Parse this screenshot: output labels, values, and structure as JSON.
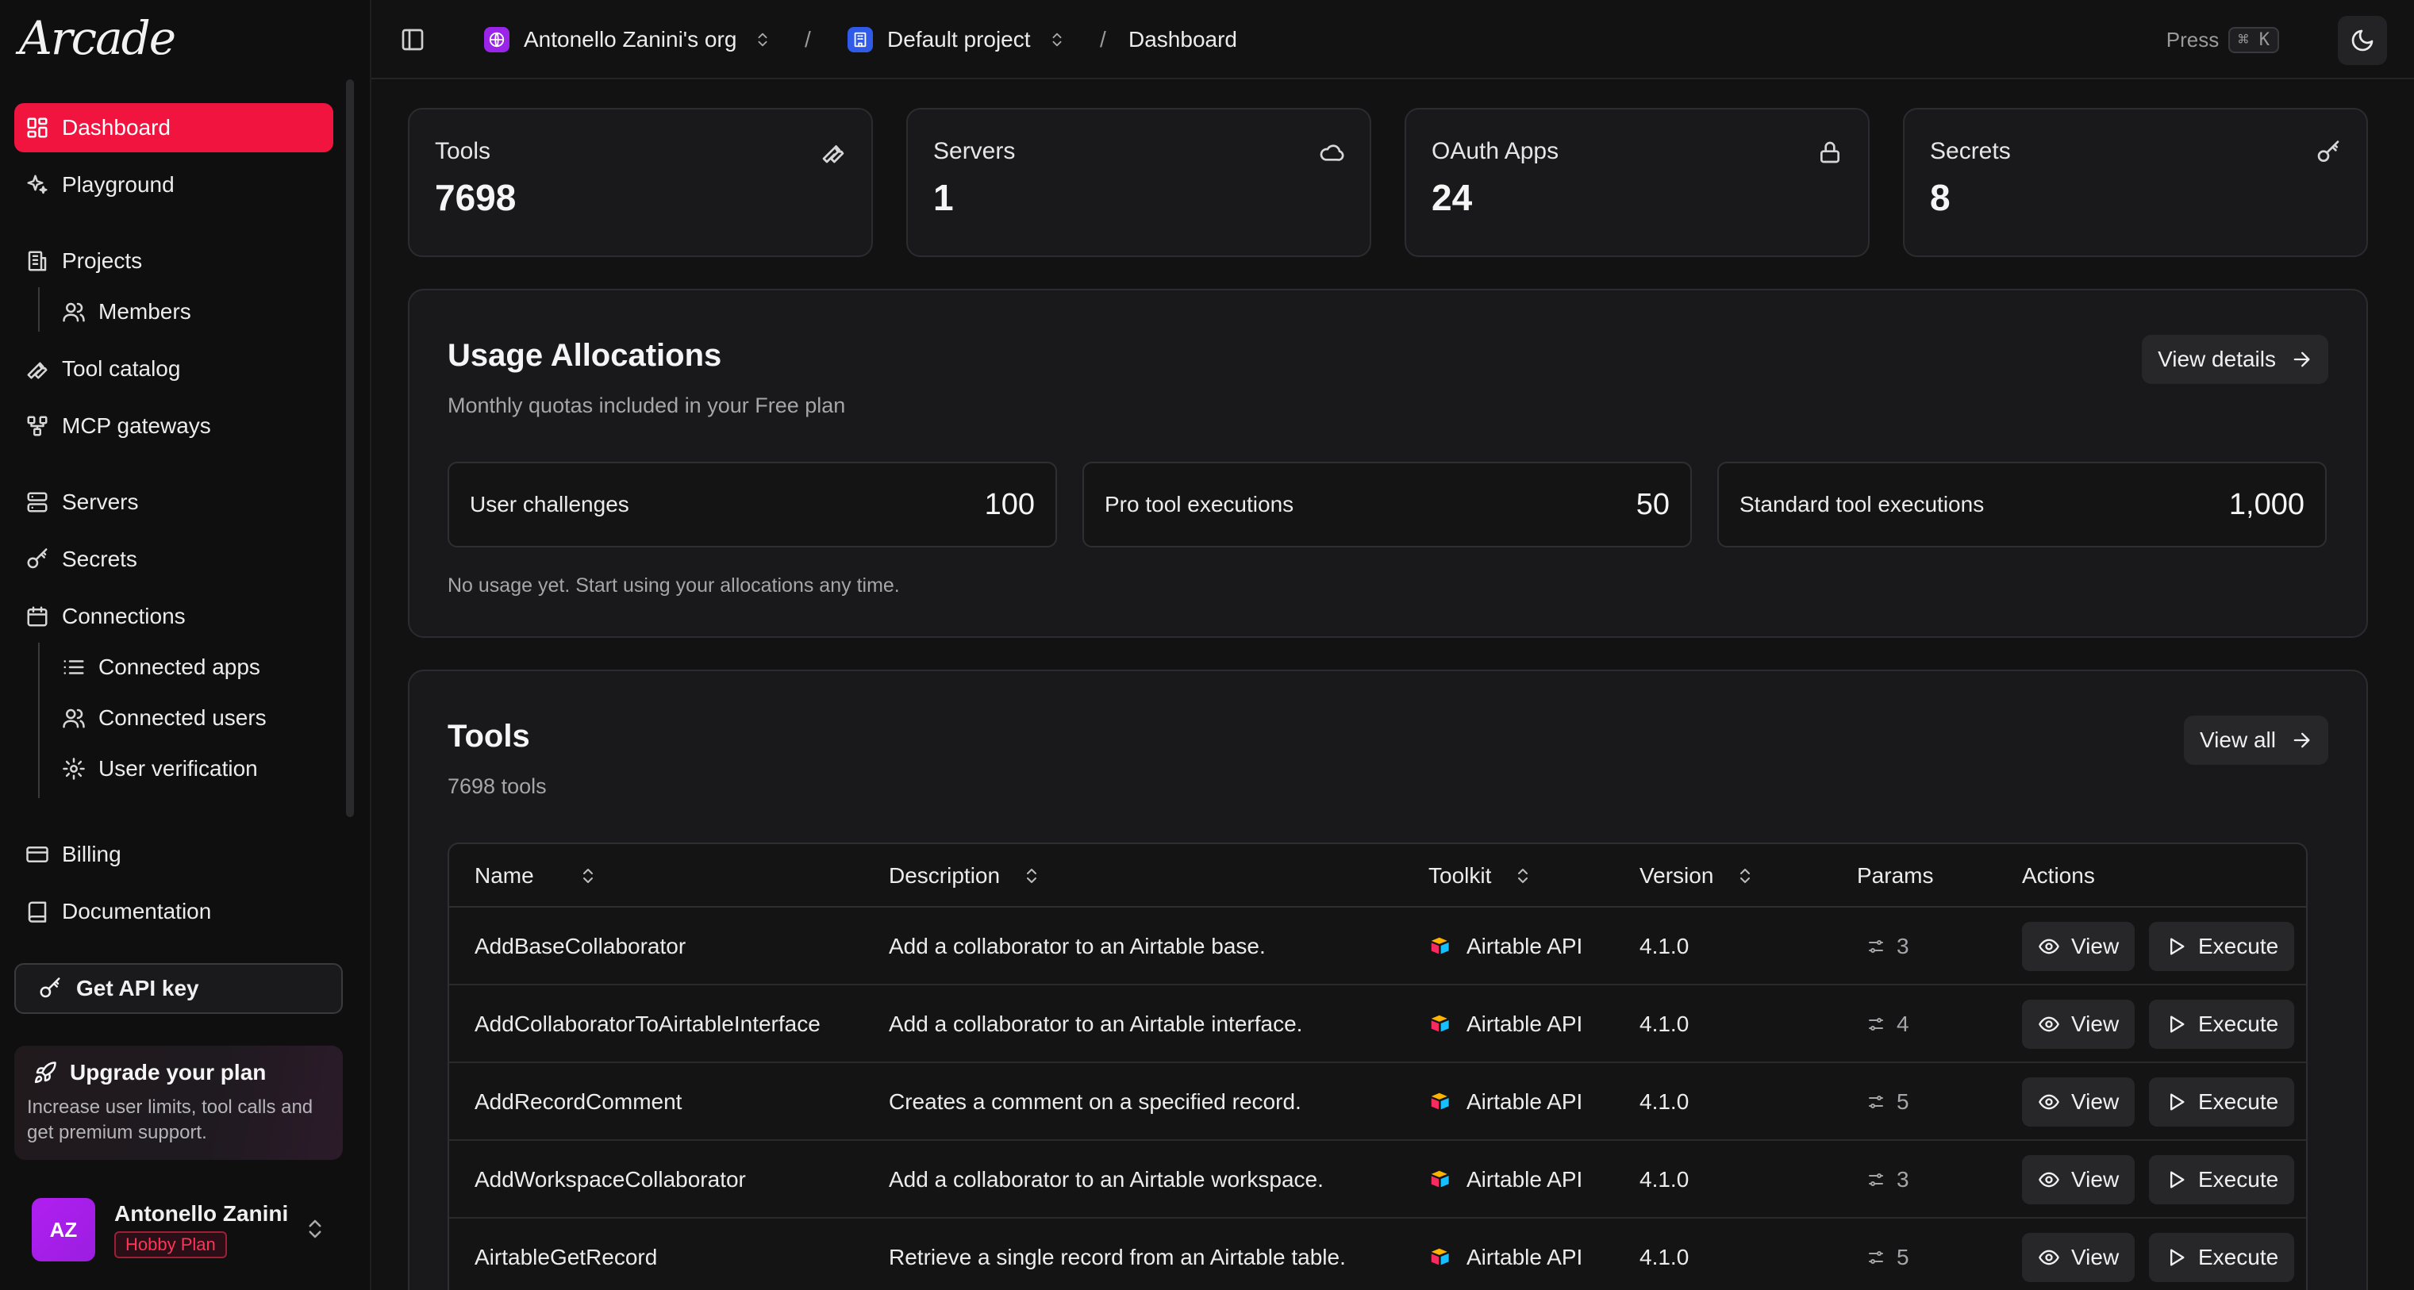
{
  "brand": {
    "logo_text": "Arcade"
  },
  "sidebar": {
    "items": [
      {
        "label": "Dashboard"
      },
      {
        "label": "Playground"
      },
      {
        "label": "Projects"
      },
      {
        "label": "Members"
      },
      {
        "label": "Tool catalog"
      },
      {
        "label": "MCP gateways"
      },
      {
        "label": "Servers"
      },
      {
        "label": "Secrets"
      },
      {
        "label": "Connections"
      },
      {
        "label": "Connected apps"
      },
      {
        "label": "Connected users"
      },
      {
        "label": "User verification"
      },
      {
        "label": "Billing"
      },
      {
        "label": "Documentation"
      }
    ],
    "api_key_label": "Get API key",
    "upgrade": {
      "title": "Upgrade your plan",
      "description": "Increase user limits, tool calls and get premium support."
    },
    "user": {
      "initials": "AZ",
      "name": "Antonello Zanini",
      "plan": "Hobby Plan"
    }
  },
  "topbar": {
    "org": "Antonello Zanini's org",
    "project": "Default project",
    "page": "Dashboard",
    "separator": "/",
    "press_label": "Press",
    "shortcut": "⌘ K"
  },
  "stats": [
    {
      "label": "Tools",
      "value": "7698",
      "icon": "wrench-icon"
    },
    {
      "label": "Servers",
      "value": "1",
      "icon": "cloud-icon"
    },
    {
      "label": "OAuth Apps",
      "value": "24",
      "icon": "lock-icon"
    },
    {
      "label": "Secrets",
      "value": "8",
      "icon": "key-icon"
    }
  ],
  "usage": {
    "title": "Usage Allocations",
    "subtitle": "Monthly quotas included in your Free plan",
    "details_label": "View details",
    "quotas": [
      {
        "label": "User challenges",
        "value": "100"
      },
      {
        "label": "Pro tool executions",
        "value": "50"
      },
      {
        "label": "Standard tool executions",
        "value": "1,000"
      }
    ],
    "note": "No usage yet. Start using your allocations any time."
  },
  "tools": {
    "title": "Tools",
    "count_label": "7698 tools",
    "view_all_label": "View all",
    "columns": [
      "Name",
      "Description",
      "Toolkit",
      "Version",
      "Params",
      "Actions"
    ],
    "view_label": "View",
    "execute_label": "Execute",
    "rows": [
      {
        "name": "AddBaseCollaborator",
        "description": "Add a collaborator to an Airtable base.",
        "toolkit": "Airtable API",
        "version": "4.1.0",
        "params": "3"
      },
      {
        "name": "AddCollaboratorToAirtableInterface",
        "description": "Add a collaborator to an Airtable interface.",
        "toolkit": "Airtable API",
        "version": "4.1.0",
        "params": "4"
      },
      {
        "name": "AddRecordComment",
        "description": "Creates a comment on a specified record.",
        "toolkit": "Airtable API",
        "version": "4.1.0",
        "params": "5"
      },
      {
        "name": "AddWorkspaceCollaborator",
        "description": "Add a collaborator to an Airtable workspace.",
        "toolkit": "Airtable API",
        "version": "4.1.0",
        "params": "3"
      },
      {
        "name": "AirtableGetRecord",
        "description": "Retrieve a single record from an Airtable table.",
        "toolkit": "Airtable API",
        "version": "4.1.0",
        "params": "5"
      }
    ]
  },
  "colors": {
    "accent": "#f0143f",
    "background": "#0f0f10",
    "panel": "#19191b"
  }
}
